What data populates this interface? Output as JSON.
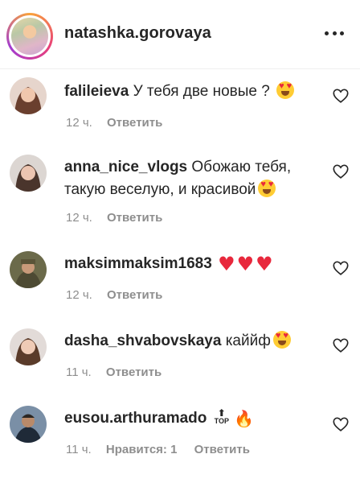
{
  "header": {
    "username": "natashka.gorovaya"
  },
  "actions": {
    "reply_label": "Ответить"
  },
  "comments": [
    {
      "username": "falileieva",
      "text": "У тебя две новые ?",
      "emoji": "heart-eyes",
      "time": "12 ч."
    },
    {
      "username": "anna_nice_vlogs",
      "text": "Обожаю тебя, такую веселую, и красивой",
      "emoji": "heart-eyes",
      "time": "12 ч."
    },
    {
      "username": "maksimmaksim1683",
      "text": "",
      "emoji": "three-red-hearts",
      "time": "12 ч."
    },
    {
      "username": "dasha_shvabovskaya",
      "text": "каййф",
      "emoji": "heart-eyes",
      "time": "11 ч."
    },
    {
      "username": "eusou.arthuramado",
      "text": "",
      "emoji": "top-and-fire",
      "top_label": "TOP",
      "time": "11 ч.",
      "likes_label": "Нравится: 1"
    }
  ],
  "colors": {
    "text": "#262626",
    "secondary": "#8e8e8e",
    "divider": "#efefef"
  },
  "icons": [
    "more-icon",
    "heart-outline-icon"
  ]
}
